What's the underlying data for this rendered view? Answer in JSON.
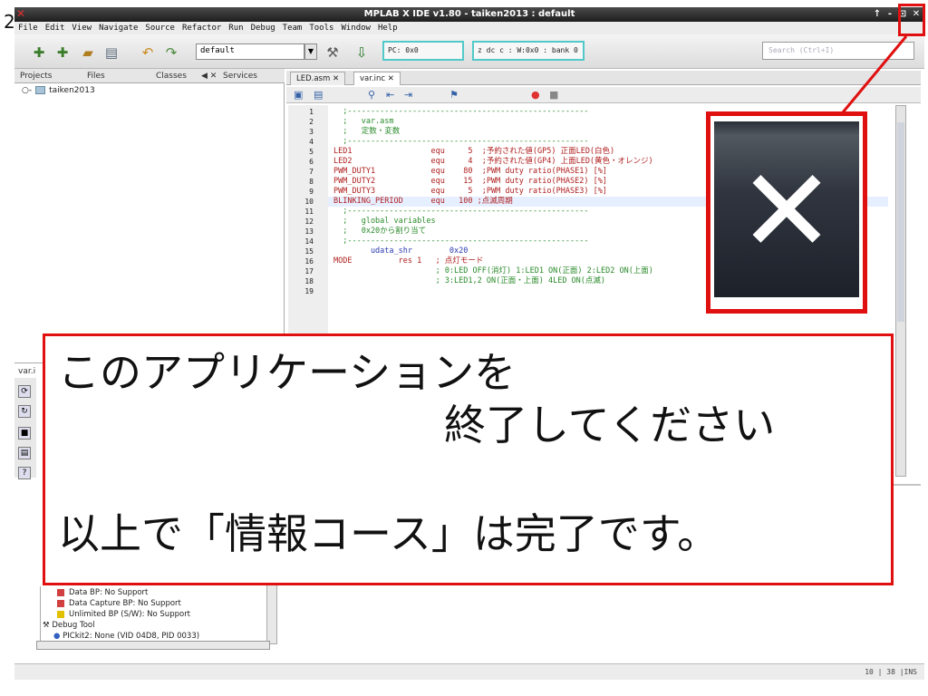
{
  "slide_number": "2",
  "window": {
    "title": "MPLAB X IDE v1.80 - taiken2013 : default",
    "controls": [
      "↑",
      "-",
      "⊡",
      "✕"
    ]
  },
  "menu": [
    "File",
    "Edit",
    "View",
    "Navigate",
    "Source",
    "Refactor",
    "Run",
    "Debug",
    "Team",
    "Tools",
    "Window",
    "Help"
  ],
  "toolbar": {
    "configuration": "default",
    "pc_register": "PC: 0x0",
    "status_register": "z dc c  : W:0x0 : bank 0",
    "search_placeholder": "Search (Ctrl+I)"
  },
  "left_panel": {
    "tabs": [
      "Projects",
      "Files",
      "Classes",
      "Services"
    ],
    "project_name": "taiken2013",
    "navigator_tab": "var.i",
    "dashboard_items": [
      {
        "text": "Data BP: No Support",
        "color": "#d04040"
      },
      {
        "text": "Data Capture BP: No Support",
        "color": "#d04040"
      },
      {
        "text": "Unlimited BP (S/W): No Support",
        "color": "#e0c000"
      },
      {
        "text": "Debug Tool",
        "color": "#777777"
      },
      {
        "text": "PICkit2: None (VID 04D8, PID 0033)",
        "color": "#3060c0"
      }
    ]
  },
  "editor": {
    "tabs": [
      "LED.asm",
      "var.inc"
    ],
    "active_tab": "var.inc",
    "line_numbers": [
      "1",
      "2",
      "3",
      "4",
      "5",
      "6",
      "7",
      "8",
      "9",
      "10",
      "11",
      "12",
      "13",
      "14",
      "15",
      "16",
      "17",
      "18",
      "19"
    ],
    "lines": [
      {
        "t": "  ;----------------------------------------------------",
        "c": "cmt"
      },
      {
        "t": "  ;   var.asm",
        "c": "cmt"
      },
      {
        "t": "  ;   定数・変数",
        "c": "cmt"
      },
      {
        "t": "  ;----------------------------------------------------",
        "c": "cmt"
      },
      {
        "t": "LED1                 equ     5  ;予約された値(GP5) 正面LED(白色)",
        "c": "lbl"
      },
      {
        "t": "LED2                 equ     4  ;予約された値(GP4) 上面LED(黄色・オレンジ)",
        "c": "lbl"
      },
      {
        "t": "PWM_DUTY1            equ    80  ;PWM duty ratio(PHASE1) [%]",
        "c": "lbl"
      },
      {
        "t": "PWM_DUTY2            equ    15  ;PWM duty ratio(PHASE2) [%]",
        "c": "lbl"
      },
      {
        "t": "PWM_DUTY3            equ     5  ;PWM duty ratio(PHASE3) [%]",
        "c": "lbl"
      },
      {
        "t": "BLINKING_PERIOD      equ   100 ;点滅周期",
        "c": "lbl"
      },
      {
        "t": "  ;----------------------------------------------------",
        "c": "cmt"
      },
      {
        "t": "  ;   global variables",
        "c": "cmt"
      },
      {
        "t": "  ;   0x20から割り当て",
        "c": "cmt"
      },
      {
        "t": "  ;----------------------------------------------------",
        "c": "cmt"
      },
      {
        "t": "        udata_shr        0x20",
        "c": "kw"
      },
      {
        "t": "MODE          res 1   ; 点灯モード",
        "c": "lbl"
      },
      {
        "t": "                      ; 0:LED OFF(消灯) 1:LED1 ON(正面) 2:LED2 ON(上面)",
        "c": "cmt"
      },
      {
        "t": "                      ; 3:LED1,2 ON(正面・上面) 4LED ON(点滅)",
        "c": "cmt"
      },
      {
        "t": "",
        "c": "cmt"
      }
    ],
    "highlight_line": 9
  },
  "status_bar": "10 | 38 |INS",
  "instruction": {
    "line1": "このアプリケーションを",
    "line2": "終了してください",
    "line3": "以上で「情報コース」は完了です。"
  },
  "accent": "#e01010"
}
